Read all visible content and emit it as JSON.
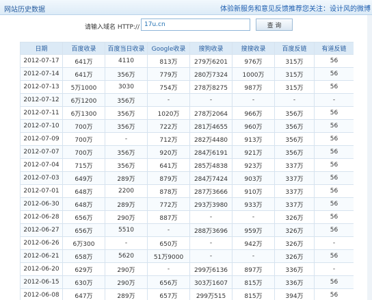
{
  "topbar": {
    "title": "网站历史数据",
    "notice": "体验新服务和意见反馈推荐您关注：设计风的微博"
  },
  "search": {
    "label": "请输入域名 HTTP://",
    "value": "17u.cn",
    "button": "查 询"
  },
  "table": {
    "columns": [
      "日期",
      "百度收录",
      "百度当日收录",
      "Google收录",
      "搜狗收录",
      "搜搜收录",
      "百度反链",
      "有道反链"
    ],
    "rows": [
      [
        "2012-07-17",
        "641万",
        "4110",
        "813万",
        "279万6201",
        "976万",
        "315万",
        "56"
      ],
      [
        "2012-07-14",
        "641万",
        "356万",
        "779万",
        "280万7324",
        "1000万",
        "315万",
        "56"
      ],
      [
        "2012-07-13",
        "5万1000",
        "3030",
        "754万",
        "278万8275",
        "987万",
        "315万",
        "56"
      ],
      [
        "2012-07-12",
        "6万1200",
        "356万",
        "-",
        "-",
        "-",
        "-",
        "-"
      ],
      [
        "2012-07-11",
        "6万1300",
        "356万",
        "1020万",
        "278万2064",
        "966万",
        "356万",
        "56"
      ],
      [
        "2012-07-10",
        "700万",
        "356万",
        "722万",
        "281万4655",
        "960万",
        "356万",
        "56"
      ],
      [
        "2012-07-09",
        "700万",
        "-",
        "712万",
        "282万4480",
        "913万",
        "356万",
        "56"
      ],
      [
        "2012-07-07",
        "700万",
        "356万",
        "920万",
        "284万6191",
        "921万",
        "356万",
        "56"
      ],
      [
        "2012-07-04",
        "715万",
        "356万",
        "641万",
        "285万4838",
        "923万",
        "337万",
        "56"
      ],
      [
        "2012-07-03",
        "649万",
        "289万",
        "879万",
        "284万7424",
        "903万",
        "337万",
        "56"
      ],
      [
        "2012-07-01",
        "648万",
        "2200",
        "878万",
        "287万3666",
        "910万",
        "337万",
        "56"
      ],
      [
        "2012-06-30",
        "648万",
        "289万",
        "772万",
        "293万3980",
        "933万",
        "337万",
        "56"
      ],
      [
        "2012-06-28",
        "656万",
        "290万",
        "887万",
        "-",
        "-",
        "326万",
        "56"
      ],
      [
        "2012-06-27",
        "656万",
        "5510",
        "-",
        "288万3696",
        "959万",
        "326万",
        "56"
      ],
      [
        "2012-06-26",
        "6万300",
        "-",
        "650万",
        "-",
        "942万",
        "326万",
        "-"
      ],
      [
        "2012-06-21",
        "658万",
        "5620",
        "51万9000",
        "-",
        "-",
        "326万",
        "56"
      ],
      [
        "2012-06-20",
        "629万",
        "290万",
        "-",
        "299万6136",
        "897万",
        "336万",
        "-"
      ],
      [
        "2012-06-15",
        "630万",
        "290万",
        "656万",
        "303万1607",
        "815万",
        "336万",
        "56"
      ],
      [
        "2012-06-08",
        "647万",
        "289万",
        "657万",
        "299万515",
        "815万",
        "394万",
        "56"
      ]
    ]
  }
}
